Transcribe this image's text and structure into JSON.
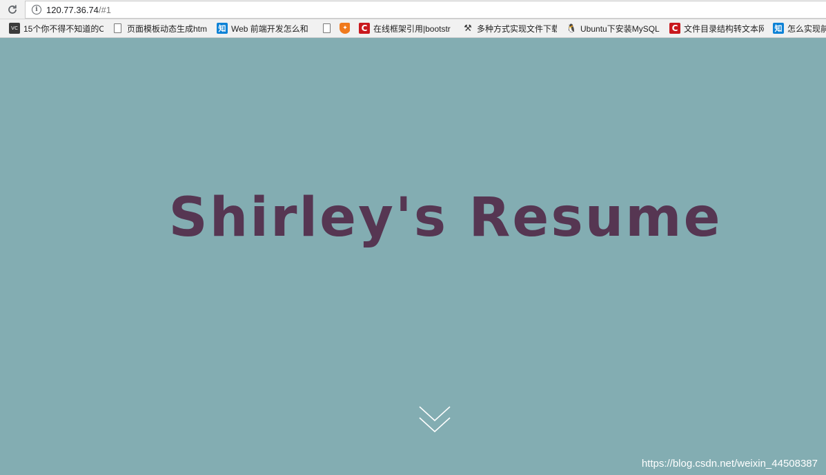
{
  "browser": {
    "url_host": "120.77.36.74",
    "url_rest": "/#1"
  },
  "bookmarks": [
    {
      "icon": "vc-icon",
      "label": "15个你不得不知道的C"
    },
    {
      "icon": "page-icon",
      "label": "页面模板动态生成htm"
    },
    {
      "icon": "zhihu-icon",
      "label": "Web 前端开发怎么和"
    },
    {
      "icon": "page-icon",
      "label": ""
    },
    {
      "icon": "shield-icon",
      "label": ""
    },
    {
      "icon": "csdn-icon",
      "label": "在线框架引用|bootstr"
    },
    {
      "icon": "tool-icon",
      "label": "多种方式实现文件下载"
    },
    {
      "icon": "tux-icon",
      "label": "Ubuntu下安装MySQL"
    },
    {
      "icon": "csdn-icon",
      "label": "文件目录结构转文本网"
    },
    {
      "icon": "zhihu-icon",
      "label": "怎么实现前"
    }
  ],
  "hero": {
    "title": "Shirley's  Resume",
    "title_color": "#563652",
    "background": "#83adb2"
  },
  "watermark": "https://blog.csdn.net/weixin_44508387"
}
